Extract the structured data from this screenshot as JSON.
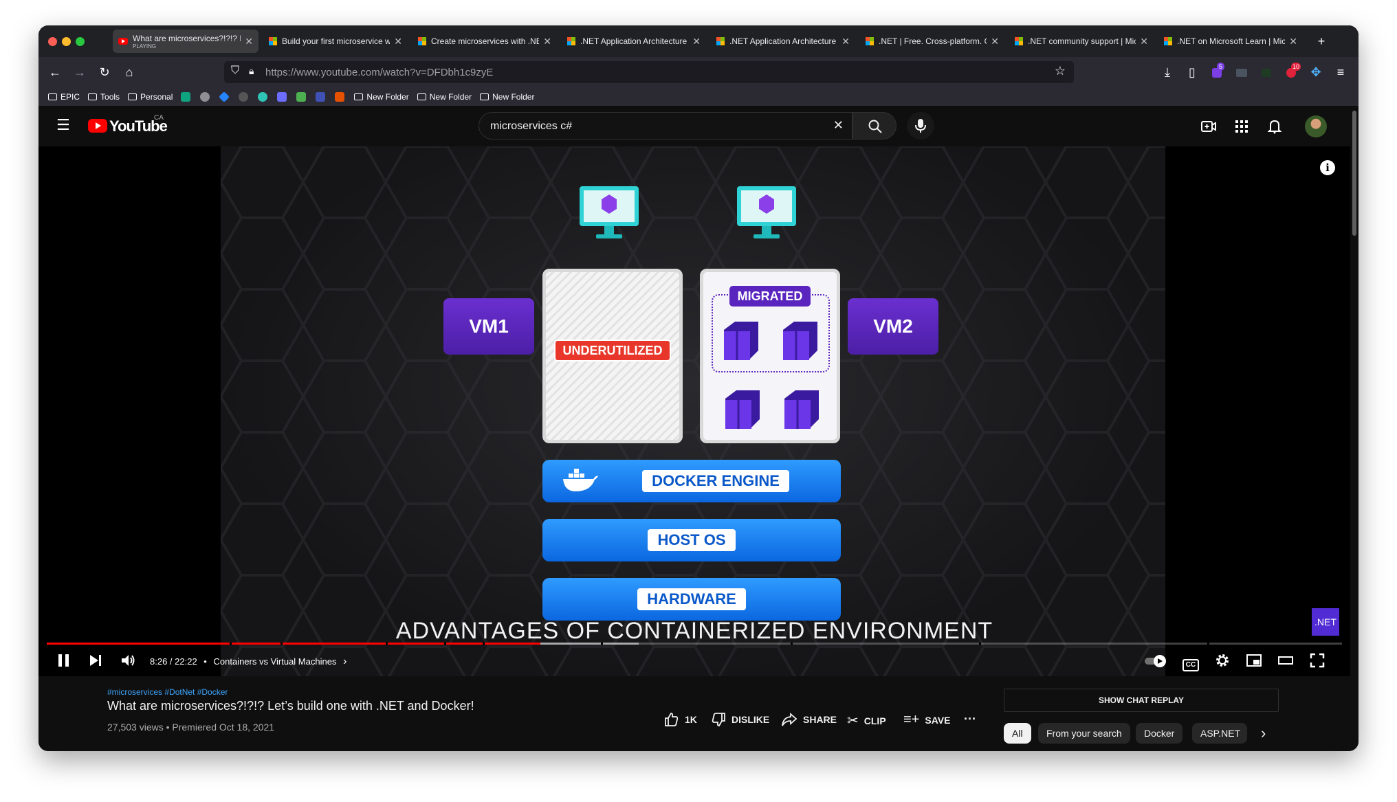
{
  "browser": {
    "tabs": [
      {
        "title": "What are microservices?!?!? Le",
        "subtitle": "PLAYING",
        "icon": "youtube-icon",
        "active": true
      },
      {
        "title": "Build your first microservice w",
        "icon": "microsoft-icon"
      },
      {
        "title": "Create microservices with .NE",
        "icon": "microsoft-icon"
      },
      {
        "title": ".NET Application Architecture",
        "icon": "microsoft-icon"
      },
      {
        "title": ".NET Application Architecture",
        "icon": "microsoft-icon"
      },
      {
        "title": ".NET | Free. Cross-platform. O",
        "icon": "microsoft-icon"
      },
      {
        "title": ".NET community support | Mic",
        "icon": "microsoft-icon"
      },
      {
        "title": ".NET on Microsoft Learn | Micr",
        "icon": "microsoft-icon"
      }
    ],
    "url": {
      "host": "https://www.youtube.com",
      "path": "/watch?v=DFDbh1c9zyE"
    },
    "toolbar_badges": {
      "extension_count": "5",
      "adblock_count": "10"
    },
    "bookmarks": [
      {
        "label": "EPIC",
        "type": "folder"
      },
      {
        "label": "Tools",
        "type": "folder"
      },
      {
        "label": "Personal",
        "type": "folder"
      },
      {
        "label": "New Folder",
        "type": "folder"
      },
      {
        "label": "New Folder",
        "type": "folder"
      },
      {
        "label": "New Folder",
        "type": "folder"
      }
    ]
  },
  "youtube": {
    "logo_text": "YouTube",
    "region": "CA",
    "search_value": "microservices c#"
  },
  "video": {
    "vm1": "VM1",
    "vm2": "VM2",
    "underutilized": "UNDERUTILIZED",
    "migrated": "MIGRATED",
    "docker_engine": "DOCKER ENGINE",
    "host_os": "HOST OS",
    "hardware": "HARDWARE",
    "caption": "ADVANTAGES OF CONTAINERIZED ENVIRONMENT",
    "watermark": ".NET",
    "played_fraction": 0.381,
    "buffered_to_fraction": 0.457
  },
  "controls": {
    "time": "8:26 / 22:22",
    "separator": "•",
    "chapter": "Containers vs Virtual Machines",
    "chapter_chevron": "›",
    "cc_label": "CC"
  },
  "info": {
    "hashtags": "#microservices #DotNet #Docker",
    "title": "What are microservices?!?!? Let’s build one with .NET and Docker!",
    "meta": "27,503 views • Premiered Oct 18, 2021",
    "likes": "1K",
    "dislike": "DISLIKE",
    "share": "SHARE",
    "clip": "CLIP",
    "save": "SAVE",
    "more": "···",
    "chat_replay": "SHOW CHAT REPLAY",
    "chips": [
      "All",
      "From your search",
      "Docker",
      "ASP.NET"
    ],
    "chips_next": "›"
  },
  "colors": {
    "accent_red": "#ff0000",
    "vm_purple": "#5a25bf",
    "docker_blue": "#1a7ff0"
  }
}
